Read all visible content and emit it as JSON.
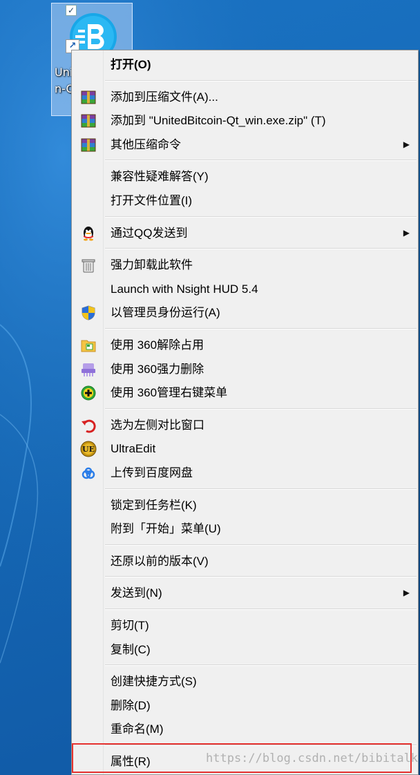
{
  "desktop": {
    "icon_label": "Uni\nn-Q"
  },
  "menu": {
    "items": [
      {
        "key": "open",
        "label": "打开(O)",
        "bold": true,
        "icon": "none"
      },
      {
        "key": "add-archive",
        "label": "添加到压缩文件(A)...",
        "icon": "winrar-icon"
      },
      {
        "key": "add-zip",
        "label": "添加到 \"UnitedBitcoin-Qt_win.exe.zip\" (T)",
        "icon": "winrar-icon"
      },
      {
        "key": "other-compress",
        "label": "其他压缩命令",
        "icon": "winrar-icon",
        "submenu": true
      },
      {
        "key": "compat",
        "label": "兼容性疑难解答(Y)",
        "icon": "none"
      },
      {
        "key": "open-location",
        "label": "打开文件位置(I)",
        "icon": "none"
      },
      {
        "key": "send-qq",
        "label": "通过QQ发送到",
        "icon": "qq-penguin-icon",
        "submenu": true
      },
      {
        "key": "uninstall",
        "label": "强力卸载此软件",
        "icon": "trash-icon"
      },
      {
        "key": "nsight",
        "label": "Launch with Nsight HUD 5.4",
        "icon": "none"
      },
      {
        "key": "run-admin",
        "label": "以管理员身份运行(A)",
        "icon": "uac-shield-icon"
      },
      {
        "key": "unlock-360",
        "label": "使用 360解除占用",
        "icon": "folder-360-icon"
      },
      {
        "key": "delete-360",
        "label": "使用 360强力删除",
        "icon": "shredder-360-icon"
      },
      {
        "key": "manage-360",
        "label": "使用 360管理右键菜单",
        "icon": "plus-360-icon"
      },
      {
        "key": "compare-left",
        "label": "选为左侧对比窗口",
        "icon": "undo-red-icon"
      },
      {
        "key": "ultraedit",
        "label": "UltraEdit",
        "icon": "ultraedit-icon"
      },
      {
        "key": "baidu",
        "label": "上传到百度网盘",
        "icon": "baidu-cloud-icon"
      },
      {
        "key": "pin-taskbar",
        "label": "锁定到任务栏(K)",
        "icon": "none"
      },
      {
        "key": "pin-start",
        "label": "附到「开始」菜单(U)",
        "icon": "none"
      },
      {
        "key": "restore",
        "label": "还原以前的版本(V)",
        "icon": "none"
      },
      {
        "key": "send-to",
        "label": "发送到(N)",
        "icon": "none",
        "submenu": true
      },
      {
        "key": "cut",
        "label": "剪切(T)",
        "icon": "none"
      },
      {
        "key": "copy",
        "label": "复制(C)",
        "icon": "none"
      },
      {
        "key": "shortcut",
        "label": "创建快捷方式(S)",
        "icon": "none"
      },
      {
        "key": "delete",
        "label": "删除(D)",
        "icon": "none"
      },
      {
        "key": "rename",
        "label": "重命名(M)",
        "icon": "none"
      },
      {
        "key": "properties",
        "label": "属性(R)",
        "icon": "none"
      }
    ],
    "submenu_arrow": "▶"
  },
  "watermark": "https://blog.csdn.net/bibitalk",
  "colors": {
    "menu_bg": "#f0f0f0",
    "highlight_box": "#e5312f",
    "desktop_bg": "#1668b5"
  }
}
